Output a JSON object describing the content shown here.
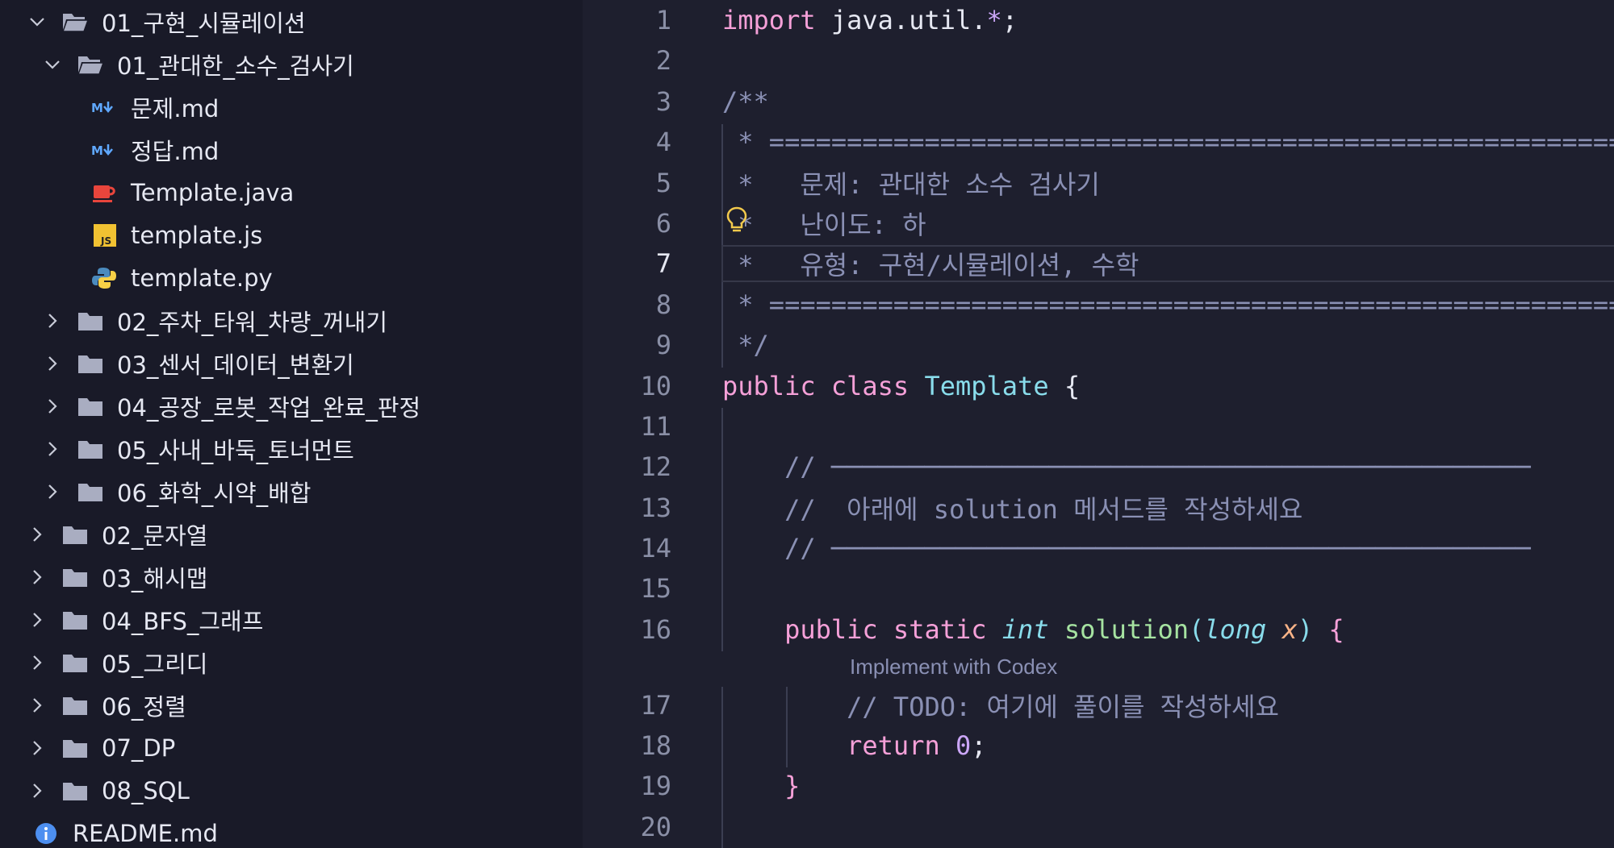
{
  "sidebar": {
    "items": [
      {
        "label": "01_구현_시뮬레이션",
        "kind": "folder-open",
        "level": 0
      },
      {
        "label": "01_관대한_소수_검사기",
        "kind": "folder-open",
        "level": 1
      },
      {
        "label": "문제.md",
        "kind": "markdown",
        "level": 2
      },
      {
        "label": "정답.md",
        "kind": "markdown",
        "level": 2
      },
      {
        "label": "Template.java",
        "kind": "java",
        "level": 2
      },
      {
        "label": "template.js",
        "kind": "js",
        "level": 2
      },
      {
        "label": "template.py",
        "kind": "python",
        "level": 2
      },
      {
        "label": "02_주차_타워_차량_꺼내기",
        "kind": "folder",
        "level": 1
      },
      {
        "label": "03_센서_데이터_변환기",
        "kind": "folder",
        "level": 1
      },
      {
        "label": "04_공장_로봇_작업_완료_판정",
        "kind": "folder",
        "level": 1
      },
      {
        "label": "05_사내_바둑_토너먼트",
        "kind": "folder",
        "level": 1
      },
      {
        "label": "06_화학_시약_배합",
        "kind": "folder",
        "level": 1
      },
      {
        "label": "02_문자열",
        "kind": "folder",
        "level": 0
      },
      {
        "label": "03_해시맵",
        "kind": "folder",
        "level": 0
      },
      {
        "label": "04_BFS_그래프",
        "kind": "folder",
        "level": 0
      },
      {
        "label": "05_그리디",
        "kind": "folder",
        "level": 0
      },
      {
        "label": "06_정렬",
        "kind": "folder",
        "level": 0
      },
      {
        "label": "07_DP",
        "kind": "folder",
        "level": 0
      },
      {
        "label": "08_SQL",
        "kind": "folder",
        "level": 0
      },
      {
        "label": "README.md",
        "kind": "info",
        "level": 0
      }
    ]
  },
  "editor": {
    "line_numbers": [
      "1",
      "2",
      "3",
      "4",
      "5",
      "6",
      "7",
      "8",
      "9",
      "10",
      "11",
      "12",
      "13",
      "14",
      "15",
      "16",
      "17",
      "18",
      "19",
      "20"
    ],
    "active_line": "7",
    "code": {
      "l1_import": "import",
      "l1_pkg": " java.util.",
      "l1_star": "*",
      "l1_semi": ";",
      "l3": "/**",
      "l4": " * ===========================================================",
      "l5": " *   문제: 관대한 소수 검사기",
      "l6": " *   난이도: 하",
      "l7": " *   유형: 구현/시뮬레이션, 수학",
      "l8": " * ===========================================================",
      "l9": " */",
      "l10_public": "public",
      "l10_class": " class",
      "l10_name": " Template",
      "l10_brace": " {",
      "l12": "    // ─────────────────────────────────────────────",
      "l13": "    //  아래에 solution 메서드를 작성하세요",
      "l14": "    // ─────────────────────────────────────────────",
      "l16_public": "    public",
      "l16_static": " static",
      "l16_int": " int",
      "l16_solution": " solution",
      "l16_paren": "(",
      "l16_long": "long",
      "l16_x": " x",
      "l16_close": ")",
      "l16_brace": " {",
      "lens": "Implement with Codex",
      "l17": "        // TODO: 여기에 풀이를 작성하세요",
      "l18_return": "        return",
      "l18_zero": " 0",
      "l18_semi": ";",
      "l19": "    }"
    },
    "colors": {
      "keyword": "#f5a0d8",
      "type": "#89dceb",
      "function": "#a6e3a1",
      "comment": "#8a90b4",
      "number": "#cba6f7",
      "param": "#fab387"
    }
  }
}
